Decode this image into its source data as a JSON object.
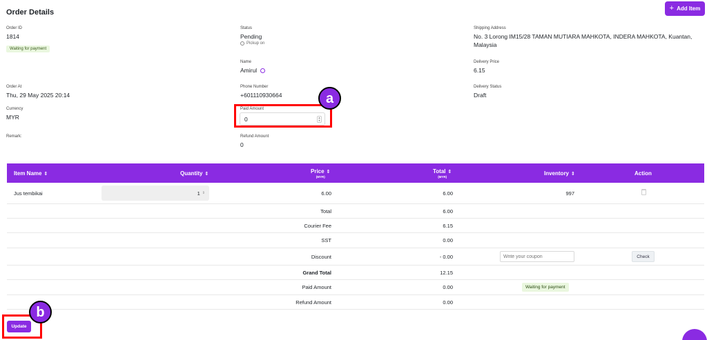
{
  "header": {
    "title": "Order Details",
    "add_item_label": "Add Item"
  },
  "order": {
    "id_label": "Order ID",
    "id": "1814",
    "payment_badge": "Waiting for payment",
    "status_label": "Status",
    "status": "Pending",
    "pickup": "Pickup on",
    "shipping_label": "Shipping Address",
    "shipping_line1": "No. 3 Lorong IM15/28 TAMAN MUTIARA MAHKOTA, INDERA MAHKOTA, Kuantan,",
    "shipping_line2": "Malaysia",
    "name_label": "Name",
    "name": "Amirul",
    "delivery_price_label": "Delivery Price",
    "delivery_price": "6.15",
    "order_at_label": "Order At",
    "order_at": "Thu, 29 May 2025 20:14",
    "phone_label": "Phone Number",
    "phone": "+601110930664",
    "delivery_status_label": "Delivery Status",
    "delivery_status": "Draft",
    "currency_label": "Currency",
    "currency": "MYR",
    "paid_amount_label": "Paid Amount",
    "paid_amount_value": "0",
    "remark_label": "Remark:",
    "refund_amount_label": "Refund Amount",
    "refund_amount": "0"
  },
  "table": {
    "headers": {
      "item_name": "Item Name",
      "quantity": "Quantity",
      "price": "Price",
      "price_unit": "(MYR)",
      "total": "Total",
      "total_unit": "(MYR)",
      "inventory": "Inventory",
      "action": "Action"
    },
    "item": {
      "name": "Jus tembikai",
      "quantity": "1",
      "price": "6.00",
      "total": "6.00",
      "inventory": "997"
    },
    "summary": {
      "total_label": "Total",
      "total": "6.00",
      "courier_label": "Courier Fee",
      "courier": "6.15",
      "sst_label": "SST",
      "sst": "0.00",
      "discount_label": "Discount",
      "discount": "- 0.00",
      "coupon_placeholder": "Write your coupon",
      "check_label": "Check",
      "grand_label": "Grand Total",
      "grand": "12.15",
      "paid_label": "Paid Amount",
      "paid": "0.00",
      "paid_badge": "Waiting for payment",
      "refund_label": "Refund Amount",
      "refund": "0.00"
    }
  },
  "footer": {
    "update_label": "Update"
  },
  "annotations": {
    "marker_a": "a",
    "marker_b": "b"
  },
  "colors": {
    "accent": "#8a2be2",
    "highlight": "#ff0000"
  }
}
